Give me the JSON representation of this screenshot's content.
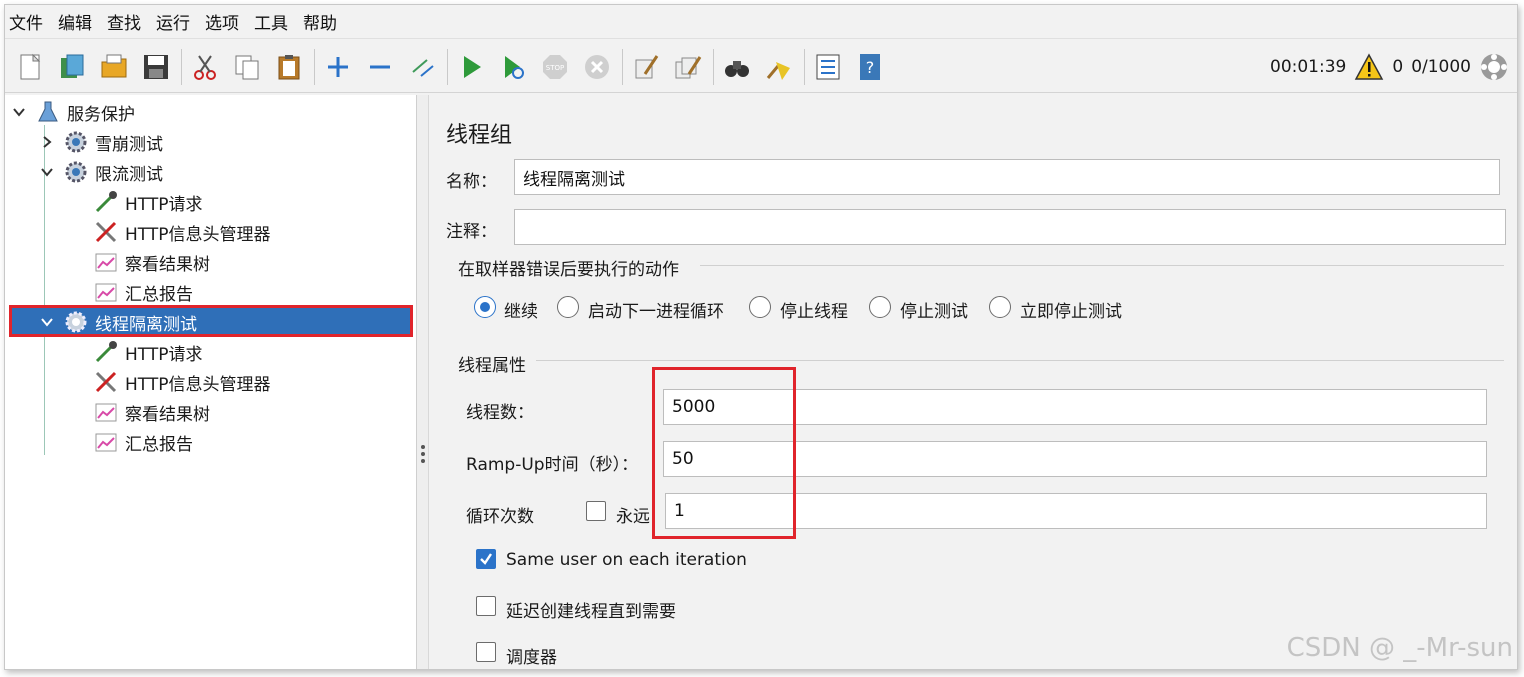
{
  "menu": [
    "文件",
    "编辑",
    "查找",
    "运行",
    "选项",
    "工具",
    "帮助"
  ],
  "toolbar": {
    "icons": [
      "new-icon",
      "templates-icon",
      "open-icon",
      "save-icon",
      "cut-icon",
      "copy-icon",
      "paste-icon",
      "expand-icon",
      "collapse-icon",
      "toggle-icon",
      "start-icon",
      "start-no-pause-icon",
      "stop-icon",
      "shutdown-icon",
      "clear-icon",
      "clear-all-icon",
      "search-icon",
      "reset-search-icon",
      "function-helper-icon",
      "help-icon"
    ],
    "timer": "00:01:39",
    "warnings": "0",
    "threads": "0/1000"
  },
  "tree": {
    "root": "服务保护",
    "items": [
      {
        "label": "雪崩测试",
        "icon": "gear-icon",
        "expanded": false
      },
      {
        "label": "限流测试",
        "icon": "gear-icon",
        "expanded": true
      },
      {
        "label": "HTTP请求",
        "icon": "sampler-icon"
      },
      {
        "label": "HTTP信息头管理器",
        "icon": "config-tools-icon"
      },
      {
        "label": "察看结果树",
        "icon": "listener-icon"
      },
      {
        "label": "汇总报告",
        "icon": "listener-icon"
      },
      {
        "label": "线程隔离测试",
        "icon": "gear-icon",
        "expanded": true,
        "selected": true
      },
      {
        "label": "HTTP请求",
        "icon": "sampler-icon"
      },
      {
        "label": "HTTP信息头管理器",
        "icon": "config-tools-icon"
      },
      {
        "label": "察看结果树",
        "icon": "listener-icon"
      },
      {
        "label": "汇总报告",
        "icon": "listener-icon"
      }
    ]
  },
  "panel": {
    "title": "线程组",
    "name_label": "名称：",
    "name_value": "线程隔离测试",
    "comment_label": "注释：",
    "comment_value": "",
    "error_action_title": "在取样器错误后要执行的动作",
    "error_actions": [
      {
        "label": "继续",
        "selected": true
      },
      {
        "label": "启动下一进程循环",
        "selected": false
      },
      {
        "label": "停止线程",
        "selected": false
      },
      {
        "label": "停止测试",
        "selected": false
      },
      {
        "label": "立即停止测试",
        "selected": false
      }
    ],
    "thread_props_title": "线程属性",
    "threads_label": "线程数：",
    "threads_value": "5000",
    "rampup_label": "Ramp-Up时间（秒）：",
    "rampup_value": "50",
    "loop_label": "循环次数",
    "forever_label": "永远",
    "forever_checked": false,
    "loop_value": "1",
    "same_user_label": "Same user on each iteration",
    "same_user_checked": true,
    "delay_label": "延迟创建线程直到需要",
    "delay_checked": false,
    "scheduler_label": "调度器",
    "scheduler_checked": false
  },
  "watermark": "CSDN @ _-Mr-sun",
  "colors": {
    "selection": "#2f6fb8",
    "highlight_box": "#e0242b",
    "accent": "#2b73c9"
  }
}
